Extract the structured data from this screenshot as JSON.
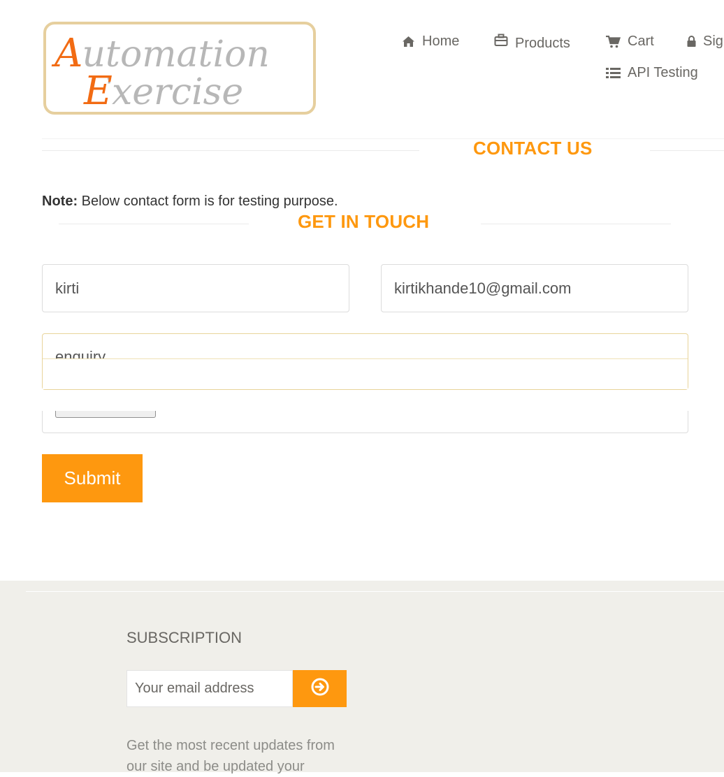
{
  "header": {
    "logo_text_line1": "Automation",
    "logo_text_line2": "Exercise",
    "nav": [
      {
        "label": "Home",
        "icon": "home-icon"
      },
      {
        "label": "Products",
        "icon": "briefcase-icon"
      },
      {
        "label": "Cart",
        "icon": "cart-icon"
      },
      {
        "label": "Sig",
        "icon": "lock-icon"
      },
      {
        "label": "API Testing",
        "icon": "list-icon"
      }
    ]
  },
  "contact": {
    "title": "CONTACT US",
    "note_label": "Note:",
    "note_text": " Below contact form is for testing purpose.",
    "form_title": "GET IN TOUCH",
    "name_value": "kirti",
    "email_value": "kirtikhande10@gmail.com",
    "subject_value": "enquiry",
    "submit_label": "Submit"
  },
  "footer": {
    "subscription_title": "SUBSCRIPTION",
    "email_placeholder": "Your email address",
    "description": "Get the most recent updates from our site and be updated your"
  },
  "colors": {
    "accent": "#fe980f",
    "footer_bg": "#f0efea",
    "nav_text": "#696763"
  }
}
